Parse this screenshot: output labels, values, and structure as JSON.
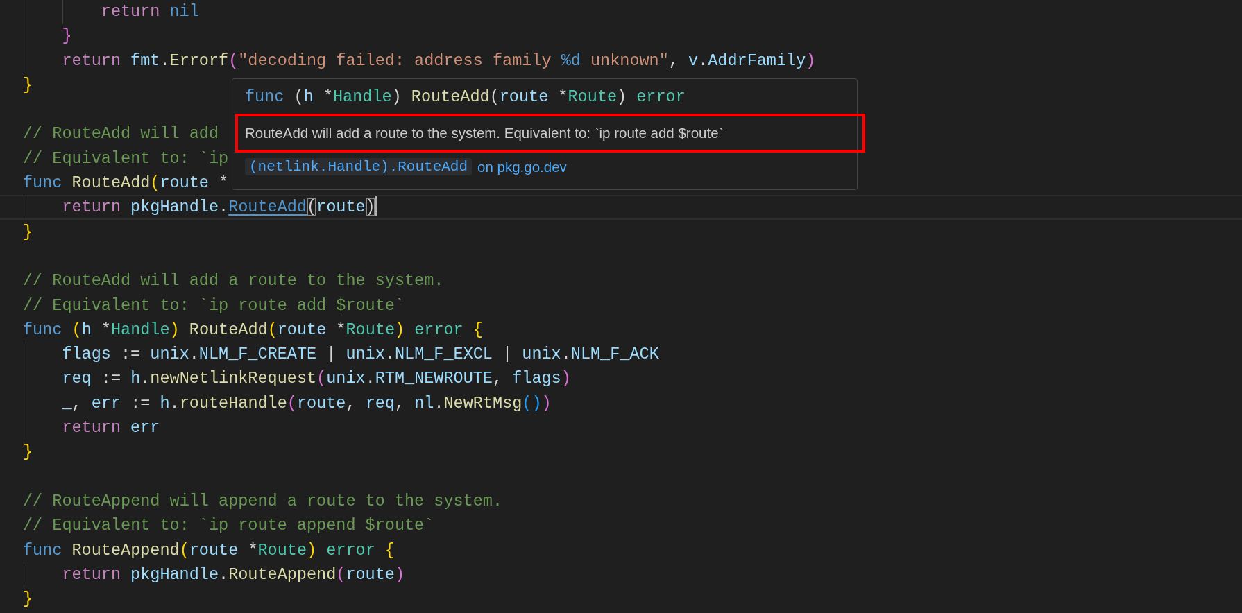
{
  "editor": {
    "lines": [
      {
        "current": false,
        "indented": true,
        "deep": true,
        "tokens": [
          {
            "kind": "control",
            "text": "return "
          },
          {
            "kind": "keyword",
            "text": "nil"
          }
        ]
      },
      {
        "current": false,
        "indented": true,
        "deep": false,
        "tokens": [
          {
            "kind": "bracket2",
            "text": "}"
          }
        ]
      },
      {
        "current": false,
        "indented": true,
        "deep": false,
        "tokens": [
          {
            "kind": "control",
            "text": "return "
          },
          {
            "kind": "variable",
            "text": "fmt"
          },
          {
            "kind": "plain",
            "text": "."
          },
          {
            "kind": "function",
            "text": "Errorf"
          },
          {
            "kind": "bracket2",
            "text": "("
          },
          {
            "kind": "string",
            "text": "\"decoding failed: address family "
          },
          {
            "kind": "format",
            "text": "%d"
          },
          {
            "kind": "string",
            "text": " unknown\""
          },
          {
            "kind": "plain",
            "text": ", "
          },
          {
            "kind": "variable",
            "text": "v"
          },
          {
            "kind": "plain",
            "text": "."
          },
          {
            "kind": "variable",
            "text": "AddrFamily"
          },
          {
            "kind": "bracket2",
            "text": ")"
          }
        ]
      },
      {
        "current": false,
        "tokens": [
          {
            "kind": "bracket1",
            "text": "}"
          }
        ]
      },
      {
        "current": false
      },
      {
        "current": false,
        "tokens": [
          {
            "kind": "comment",
            "text": "// RouteAdd will add "
          }
        ]
      },
      {
        "current": false,
        "tokens": [
          {
            "kind": "comment",
            "text": "// Equivalent to: `ip"
          }
        ]
      },
      {
        "current": false,
        "tokens": [
          {
            "kind": "keyword",
            "text": "func "
          },
          {
            "kind": "function",
            "text": "RouteAdd"
          },
          {
            "kind": "bracket1",
            "text": "("
          },
          {
            "kind": "variable",
            "text": "route"
          },
          {
            "kind": "plain",
            "text": " *"
          }
        ]
      },
      {
        "current": true,
        "indented": true,
        "deep": false,
        "tokens": [
          {
            "kind": "control",
            "text": "return "
          },
          {
            "kind": "variable",
            "text": "pkgHandle"
          },
          {
            "kind": "plain",
            "text": "."
          },
          {
            "kind": "link",
            "text": "RouteAdd"
          },
          {
            "kind": "match",
            "text": "("
          },
          {
            "kind": "variable",
            "text": "route"
          },
          {
            "kind": "match",
            "text": ")"
          }
        ]
      },
      {
        "current": false,
        "tokens": [
          {
            "kind": "bracket1",
            "text": "}"
          }
        ]
      },
      {
        "current": false
      },
      {
        "current": false,
        "tokens": [
          {
            "kind": "comment",
            "text": "// RouteAdd will add a route to the system."
          }
        ]
      },
      {
        "current": false,
        "tokens": [
          {
            "kind": "comment",
            "text": "// Equivalent to: `ip route add $route`"
          }
        ]
      },
      {
        "current": false,
        "tokens": [
          {
            "kind": "keyword",
            "text": "func "
          },
          {
            "kind": "bracket1",
            "text": "("
          },
          {
            "kind": "variable",
            "text": "h"
          },
          {
            "kind": "plain",
            "text": " *"
          },
          {
            "kind": "type",
            "text": "Handle"
          },
          {
            "kind": "bracket1",
            "text": ") "
          },
          {
            "kind": "function",
            "text": "RouteAdd"
          },
          {
            "kind": "bracket1",
            "text": "("
          },
          {
            "kind": "variable",
            "text": "route"
          },
          {
            "kind": "plain",
            "text": " *"
          },
          {
            "kind": "type",
            "text": "Route"
          },
          {
            "kind": "bracket1",
            "text": ") "
          },
          {
            "kind": "type",
            "text": "error "
          },
          {
            "kind": "bracket1",
            "text": "{"
          }
        ]
      },
      {
        "current": false,
        "indented": true,
        "deep": false,
        "tokens": [
          {
            "kind": "variable",
            "text": "flags"
          },
          {
            "kind": "plain",
            "text": " := "
          },
          {
            "kind": "variable",
            "text": "unix"
          },
          {
            "kind": "plain",
            "text": "."
          },
          {
            "kind": "variable",
            "text": "NLM_F_CREATE"
          },
          {
            "kind": "plain",
            "text": " | "
          },
          {
            "kind": "variable",
            "text": "unix"
          },
          {
            "kind": "plain",
            "text": "."
          },
          {
            "kind": "variable",
            "text": "NLM_F_EXCL"
          },
          {
            "kind": "plain",
            "text": " | "
          },
          {
            "kind": "variable",
            "text": "unix"
          },
          {
            "kind": "plain",
            "text": "."
          },
          {
            "kind": "variable",
            "text": "NLM_F_ACK"
          }
        ]
      },
      {
        "current": false,
        "indented": true,
        "deep": false,
        "tokens": [
          {
            "kind": "variable",
            "text": "req"
          },
          {
            "kind": "plain",
            "text": " := "
          },
          {
            "kind": "variable",
            "text": "h"
          },
          {
            "kind": "plain",
            "text": "."
          },
          {
            "kind": "function",
            "text": "newNetlinkRequest"
          },
          {
            "kind": "bracket2",
            "text": "("
          },
          {
            "kind": "variable",
            "text": "unix"
          },
          {
            "kind": "plain",
            "text": "."
          },
          {
            "kind": "variable",
            "text": "RTM_NEWROUTE"
          },
          {
            "kind": "plain",
            "text": ", "
          },
          {
            "kind": "variable",
            "text": "flags"
          },
          {
            "kind": "bracket2",
            "text": ")"
          }
        ]
      },
      {
        "current": false,
        "indented": true,
        "deep": false,
        "tokens": [
          {
            "kind": "variable",
            "text": "_"
          },
          {
            "kind": "plain",
            "text": ", "
          },
          {
            "kind": "variable",
            "text": "err"
          },
          {
            "kind": "plain",
            "text": " := "
          },
          {
            "kind": "variable",
            "text": "h"
          },
          {
            "kind": "plain",
            "text": "."
          },
          {
            "kind": "function",
            "text": "routeHandle"
          },
          {
            "kind": "bracket2",
            "text": "("
          },
          {
            "kind": "variable",
            "text": "route"
          },
          {
            "kind": "plain",
            "text": ", "
          },
          {
            "kind": "variable",
            "text": "req"
          },
          {
            "kind": "plain",
            "text": ", "
          },
          {
            "kind": "variable",
            "text": "nl"
          },
          {
            "kind": "plain",
            "text": "."
          },
          {
            "kind": "function",
            "text": "NewRtMsg"
          },
          {
            "kind": "bracket3",
            "text": "()"
          },
          {
            "kind": "bracket2",
            "text": ")"
          }
        ]
      },
      {
        "current": false,
        "indented": true,
        "deep": false,
        "tokens": [
          {
            "kind": "control",
            "text": "return "
          },
          {
            "kind": "variable",
            "text": "err"
          }
        ]
      },
      {
        "current": false,
        "tokens": [
          {
            "kind": "bracket1",
            "text": "}"
          }
        ]
      },
      {
        "current": false
      },
      {
        "current": false,
        "tokens": [
          {
            "kind": "comment",
            "text": "// RouteAppend will append a route to the system."
          }
        ]
      },
      {
        "current": false,
        "tokens": [
          {
            "kind": "comment",
            "text": "// Equivalent to: `ip route append $route`"
          }
        ]
      },
      {
        "current": false,
        "tokens": [
          {
            "kind": "keyword",
            "text": "func "
          },
          {
            "kind": "function",
            "text": "RouteAppend"
          },
          {
            "kind": "bracket1",
            "text": "("
          },
          {
            "kind": "variable",
            "text": "route"
          },
          {
            "kind": "plain",
            "text": " *"
          },
          {
            "kind": "type",
            "text": "Route"
          },
          {
            "kind": "bracket1",
            "text": ") "
          },
          {
            "kind": "type",
            "text": "error "
          },
          {
            "kind": "bracket1",
            "text": "{"
          }
        ]
      },
      {
        "current": false,
        "indented": true,
        "deep": false,
        "tokens": [
          {
            "kind": "control",
            "text": "return "
          },
          {
            "kind": "variable",
            "text": "pkgHandle"
          },
          {
            "kind": "plain",
            "text": "."
          },
          {
            "kind": "function",
            "text": "RouteAppend"
          },
          {
            "kind": "bracket2",
            "text": "("
          },
          {
            "kind": "variable",
            "text": "route"
          },
          {
            "kind": "bracket2",
            "text": ")"
          }
        ]
      },
      {
        "current": false,
        "tokens": [
          {
            "kind": "bracket1",
            "text": "}"
          }
        ]
      }
    ]
  },
  "hover": {
    "signature": [
      {
        "kind": "keyword",
        "text": "func"
      },
      {
        "kind": "plain",
        "text": " ("
      },
      {
        "kind": "variable",
        "text": "h"
      },
      {
        "kind": "plain",
        "text": " *"
      },
      {
        "kind": "type",
        "text": "Handle"
      },
      {
        "kind": "plain",
        "text": ") "
      },
      {
        "kind": "function",
        "text": "RouteAdd"
      },
      {
        "kind": "plain",
        "text": "("
      },
      {
        "kind": "variable",
        "text": "route"
      },
      {
        "kind": "plain",
        "text": " *"
      },
      {
        "kind": "type",
        "text": "Route"
      },
      {
        "kind": "plain",
        "text": ") "
      },
      {
        "kind": "type",
        "text": "error"
      }
    ],
    "doc": "RouteAdd will add a route to the system. Equivalent to: `ip route add $route`",
    "highlighted": true,
    "link_code": "(netlink.Handle).RouteAdd",
    "link_text": "on pkg.go.dev"
  }
}
